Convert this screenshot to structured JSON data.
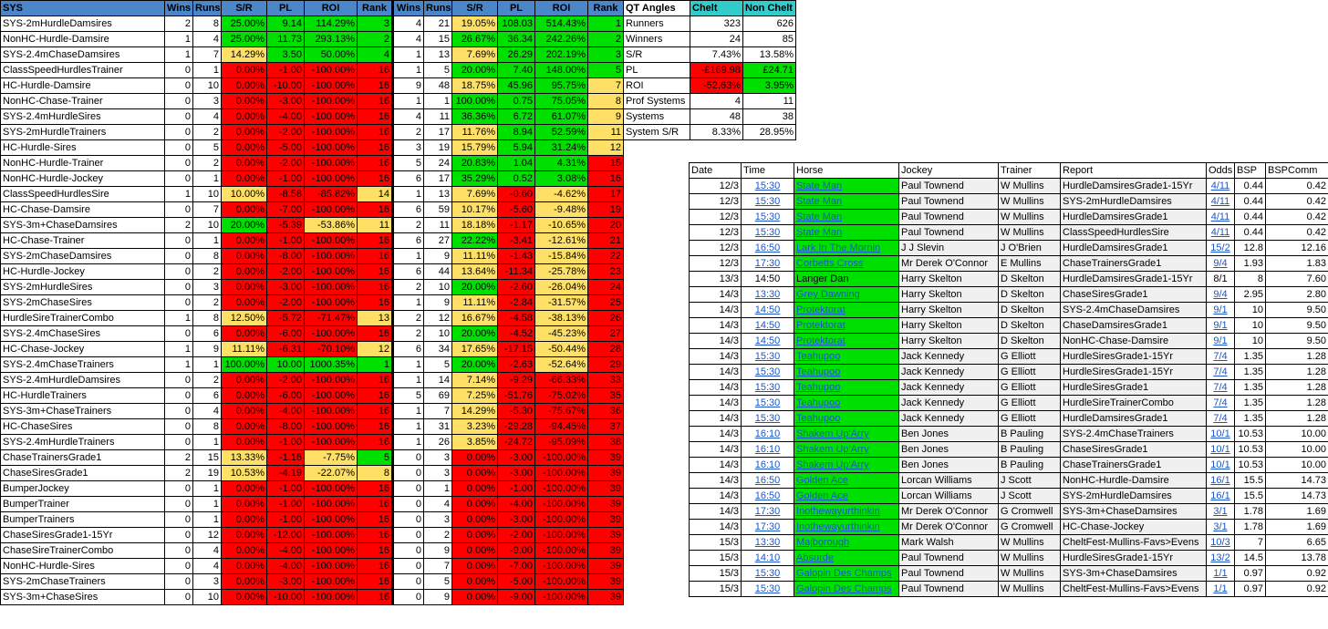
{
  "sys_headers": [
    "SYS",
    "Wins",
    "Runs",
    "S/R",
    "PL",
    "ROI",
    "Rank",
    "Wins",
    "Runs",
    "S/R",
    "PL",
    "ROI",
    "Rank"
  ],
  "sys_rows": [
    [
      "SYS-2mHurdleDamsires",
      "2",
      "8",
      "25.00%",
      "9.14",
      "114.29%",
      "3",
      "4",
      "21",
      "19.05%",
      "108.03",
      "514.43%",
      "1"
    ],
    [
      "NonHC-Hurdle-Damsire",
      "1",
      "4",
      "25.00%",
      "11.73",
      "293.13%",
      "2",
      "4",
      "15",
      "26.67%",
      "36.34",
      "242.26%",
      "2"
    ],
    [
      "SYS-2.4mChaseDamsires",
      "1",
      "7",
      "14.29%",
      "3.50",
      "50.00%",
      "4",
      "1",
      "13",
      "7.69%",
      "26.29",
      "202.19%",
      "3"
    ],
    [
      "ClassSpeedHurdlesTrainer",
      "0",
      "1",
      "0.00%",
      "-1.00",
      "-100.00%",
      "16",
      "1",
      "5",
      "20.00%",
      "7.40",
      "148.00%",
      "5"
    ],
    [
      "HC-Hurdle-Damsire",
      "0",
      "10",
      "0.00%",
      "-10.00",
      "-100.00%",
      "16",
      "9",
      "48",
      "18.75%",
      "45.96",
      "95.75%",
      "7"
    ],
    [
      "NonHC-Chase-Trainer",
      "0",
      "3",
      "0.00%",
      "-3.00",
      "-100.00%",
      "16",
      "1",
      "1",
      "100.00%",
      "0.75",
      "75.05%",
      "8"
    ],
    [
      "SYS-2.4mHurdleSires",
      "0",
      "4",
      "0.00%",
      "-4.00",
      "-100.00%",
      "16",
      "4",
      "11",
      "36.36%",
      "6.72",
      "61.07%",
      "9"
    ],
    [
      "SYS-2mHurdleTrainers",
      "0",
      "2",
      "0.00%",
      "-2.00",
      "-100.00%",
      "16",
      "2",
      "17",
      "11.76%",
      "8.94",
      "52.59%",
      "11"
    ],
    [
      "HC-Hurdle-Sires",
      "0",
      "5",
      "0.00%",
      "-5.00",
      "-100.00%",
      "16",
      "3",
      "19",
      "15.79%",
      "5.94",
      "31.24%",
      "12"
    ],
    [
      "NonHC-Hurdle-Trainer",
      "0",
      "2",
      "0.00%",
      "-2.00",
      "-100.00%",
      "16",
      "5",
      "24",
      "20.83%",
      "1.04",
      "4.31%",
      "15"
    ],
    [
      "NonHC-Hurdle-Jockey",
      "0",
      "1",
      "0.00%",
      "-1.00",
      "-100.00%",
      "16",
      "6",
      "17",
      "35.29%",
      "0.52",
      "3.08%",
      "16"
    ],
    [
      "ClassSpeedHurdlesSire",
      "1",
      "10",
      "10.00%",
      "-8.58",
      "-85.82%",
      "14",
      "1",
      "13",
      "7.69%",
      "-0.60",
      "-4.62%",
      "17"
    ],
    [
      "HC-Chase-Damsire",
      "0",
      "7",
      "0.00%",
      "-7.00",
      "-100.00%",
      "16",
      "6",
      "59",
      "10.17%",
      "-5.60",
      "-9.48%",
      "19"
    ],
    [
      "SYS-3m+ChaseDamsires",
      "2",
      "10",
      "20.00%",
      "-5.39",
      "-53.86%",
      "11",
      "2",
      "11",
      "18.18%",
      "-1.17",
      "-10.65%",
      "20"
    ],
    [
      "HC-Chase-Trainer",
      "0",
      "1",
      "0.00%",
      "-1.00",
      "-100.00%",
      "16",
      "6",
      "27",
      "22.22%",
      "-3.41",
      "-12.61%",
      "21"
    ],
    [
      "SYS-2mChaseDamsires",
      "0",
      "8",
      "0.00%",
      "-8.00",
      "-100.00%",
      "16",
      "1",
      "9",
      "11.11%",
      "-1.43",
      "-15.84%",
      "22"
    ],
    [
      "HC-Hurdle-Jockey",
      "0",
      "2",
      "0.00%",
      "-2.00",
      "-100.00%",
      "16",
      "6",
      "44",
      "13.64%",
      "-11.34",
      "-25.78%",
      "23"
    ],
    [
      "SYS-2mHurdleSires",
      "0",
      "3",
      "0.00%",
      "-3.00",
      "-100.00%",
      "16",
      "2",
      "10",
      "20.00%",
      "-2.60",
      "-26.04%",
      "24"
    ],
    [
      "SYS-2mChaseSires",
      "0",
      "2",
      "0.00%",
      "-2.00",
      "-100.00%",
      "16",
      "1",
      "9",
      "11.11%",
      "-2.84",
      "-31.57%",
      "25"
    ],
    [
      "HurdleSireTrainerCombo",
      "1",
      "8",
      "12.50%",
      "-5.72",
      "-71.47%",
      "13",
      "2",
      "12",
      "16.67%",
      "-4.58",
      "-38.13%",
      "26"
    ],
    [
      "SYS-2.4mChaseSires",
      "0",
      "6",
      "0.00%",
      "-6.00",
      "-100.00%",
      "16",
      "2",
      "10",
      "20.00%",
      "-4.52",
      "-45.23%",
      "27"
    ],
    [
      "HC-Chase-Jockey",
      "1",
      "9",
      "11.11%",
      "-6.31",
      "-70.10%",
      "12",
      "6",
      "34",
      "17.65%",
      "-17.15",
      "-50.44%",
      "28"
    ],
    [
      "SYS-2.4mChaseTrainers",
      "1",
      "1",
      "100.00%",
      "10.00",
      "1000.35%",
      "1",
      "1",
      "5",
      "20.00%",
      "-2.63",
      "-52.64%",
      "29"
    ],
    [
      "SYS-2.4mHurdleDamsires",
      "0",
      "2",
      "0.00%",
      "-2.00",
      "-100.00%",
      "16",
      "1",
      "14",
      "7.14%",
      "-9.29",
      "-66.33%",
      "33"
    ],
    [
      "HC-HurdleTrainers",
      "0",
      "6",
      "0.00%",
      "-6.00",
      "-100.00%",
      "16",
      "5",
      "69",
      "7.25%",
      "-51.76",
      "-75.02%",
      "35"
    ],
    [
      "SYS-3m+ChaseTrainers",
      "0",
      "4",
      "0.00%",
      "-4.00",
      "-100.00%",
      "16",
      "1",
      "7",
      "14.29%",
      "-5.30",
      "-75.67%",
      "36"
    ],
    [
      "HC-ChaseSires",
      "0",
      "8",
      "0.00%",
      "-8.00",
      "-100.00%",
      "16",
      "1",
      "31",
      "3.23%",
      "-29.28",
      "-94.45%",
      "37"
    ],
    [
      "SYS-2.4mHurdleTrainers",
      "0",
      "1",
      "0.00%",
      "-1.00",
      "-100.00%",
      "16",
      "1",
      "26",
      "3.85%",
      "-24.72",
      "-95.09%",
      "38"
    ],
    [
      "ChaseTrainersGrade1",
      "2",
      "15",
      "13.33%",
      "-1.16",
      "-7.75%",
      "5",
      "0",
      "3",
      "0.00%",
      "-3.00",
      "-100.00%",
      "39"
    ],
    [
      "ChaseSiresGrade1",
      "2",
      "19",
      "10.53%",
      "-4.19",
      "-22.07%",
      "8",
      "0",
      "3",
      "0.00%",
      "-3.00",
      "-100.00%",
      "39"
    ],
    [
      "BumperJockey",
      "0",
      "1",
      "0.00%",
      "-1.00",
      "-100.00%",
      "16",
      "0",
      "1",
      "0.00%",
      "-1.00",
      "-100.00%",
      "39"
    ],
    [
      "BumperTrainer",
      "0",
      "1",
      "0.00%",
      "-1.00",
      "-100.00%",
      "16",
      "0",
      "4",
      "0.00%",
      "-4.00",
      "-100.00%",
      "39"
    ],
    [
      "BumperTrainers",
      "0",
      "1",
      "0.00%",
      "-1.00",
      "-100.00%",
      "16",
      "0",
      "3",
      "0.00%",
      "-3.00",
      "-100.00%",
      "39"
    ],
    [
      "ChaseSiresGrade1-15Yr",
      "0",
      "12",
      "0.00%",
      "-12.00",
      "-100.00%",
      "16",
      "0",
      "2",
      "0.00%",
      "-2.00",
      "-100.00%",
      "39"
    ],
    [
      "ChaseSireTrainerCombo",
      "0",
      "4",
      "0.00%",
      "-4.00",
      "-100.00%",
      "16",
      "0",
      "9",
      "0.00%",
      "-9.00",
      "-100.00%",
      "39"
    ],
    [
      "NonHC-Hurdle-Sires",
      "0",
      "4",
      "0.00%",
      "-4.00",
      "-100.00%",
      "16",
      "0",
      "7",
      "0.00%",
      "-7.00",
      "-100.00%",
      "39"
    ],
    [
      "SYS-2mChaseTrainers",
      "0",
      "3",
      "0.00%",
      "-3.00",
      "-100.00%",
      "16",
      "0",
      "5",
      "0.00%",
      "-5.00",
      "-100.00%",
      "39"
    ],
    [
      "SYS-3m+ChaseSires",
      "0",
      "10",
      "0.00%",
      "-10.00",
      "-100.00%",
      "16",
      "0",
      "9",
      "0.00%",
      "-9.00",
      "-100.00%",
      "39"
    ]
  ],
  "qt": {
    "headers": [
      "QT Angles",
      "Chelt",
      "Non Chelt"
    ],
    "rows": [
      [
        "Runners",
        "323",
        "626"
      ],
      [
        "Winners",
        "24",
        "85"
      ],
      [
        "S/R",
        "7.43%",
        "13.58%"
      ],
      [
        "PL",
        "-£169.98",
        "£24.71"
      ],
      [
        "ROI",
        "-52.63%",
        "3.95%"
      ],
      [
        "Prof Systems",
        "4",
        "11"
      ],
      [
        "Systems",
        "48",
        "38"
      ],
      [
        "System S/R",
        "8.33%",
        "28.95%"
      ]
    ]
  },
  "races": {
    "headers": [
      "Date",
      "Time",
      "Horse",
      "Jockey",
      "Trainer",
      "Report",
      "Odds",
      "BSP",
      "BSPComm"
    ],
    "rows": [
      [
        "12/3",
        "15:30",
        "State Man",
        "Paul Townend",
        "W Mullins",
        "HurdleDamsiresGrade1-15Yr",
        "4/11",
        "0.44",
        "0.42"
      ],
      [
        "12/3",
        "15:30",
        "State Man",
        "Paul Townend",
        "W Mullins",
        "SYS-2mHurdleDamsires",
        "4/11",
        "0.44",
        "0.42"
      ],
      [
        "12/3",
        "15:30",
        "State Man",
        "Paul Townend",
        "W Mullins",
        "HurdleDamsiresGrade1",
        "4/11",
        "0.44",
        "0.42"
      ],
      [
        "12/3",
        "15:30",
        "State Man",
        "Paul Townend",
        "W Mullins",
        "ClassSpeedHurdlesSire",
        "4/11",
        "0.44",
        "0.42"
      ],
      [
        "12/3",
        "16:50",
        "Lark In The Mornin",
        "J J Slevin",
        "J O'Brien",
        "HurdleDamsiresGrade1",
        "15/2",
        "12.8",
        "12.16"
      ],
      [
        "12/3",
        "17:30",
        "Corbetts Cross",
        "Mr Derek O'Connor",
        "E Mullins",
        "ChaseTrainersGrade1",
        "9/4",
        "1.93",
        "1.83"
      ],
      [
        "13/3",
        "14:50",
        "Langer Dan",
        "Harry Skelton",
        "D Skelton",
        "HurdleDamsiresGrade1-15Yr",
        "8/1",
        "8",
        "7.60"
      ],
      [
        "14/3",
        "13:30",
        "Grey Dawning",
        "Harry Skelton",
        "D Skelton",
        "ChaseSiresGrade1",
        "9/4",
        "2.95",
        "2.80"
      ],
      [
        "14/3",
        "14:50",
        "Protektorat",
        "Harry Skelton",
        "D Skelton",
        "SYS-2.4mChaseDamsires",
        "9/1",
        "10",
        "9.50"
      ],
      [
        "14/3",
        "14:50",
        "Protektorat",
        "Harry Skelton",
        "D Skelton",
        "ChaseDamsiresGrade1",
        "9/1",
        "10",
        "9.50"
      ],
      [
        "14/3",
        "14:50",
        "Protektorat",
        "Harry Skelton",
        "D Skelton",
        "NonHC-Chase-Damsire",
        "9/1",
        "10",
        "9.50"
      ],
      [
        "14/3",
        "15:30",
        "Teahupoo",
        "Jack Kennedy",
        "G Elliott",
        "HurdleSiresGrade1-15Yr",
        "7/4",
        "1.35",
        "1.28"
      ],
      [
        "14/3",
        "15:30",
        "Teahupoo",
        "Jack Kennedy",
        "G Elliott",
        "HurdleSiresGrade1-15Yr",
        "7/4",
        "1.35",
        "1.28"
      ],
      [
        "14/3",
        "15:30",
        "Teahupoo",
        "Jack Kennedy",
        "G Elliott",
        "HurdleSiresGrade1",
        "7/4",
        "1.35",
        "1.28"
      ],
      [
        "14/3",
        "15:30",
        "Teahupoo",
        "Jack Kennedy",
        "G Elliott",
        "HurdleSireTrainerCombo",
        "7/4",
        "1.35",
        "1.28"
      ],
      [
        "14/3",
        "15:30",
        "Teahupoo",
        "Jack Kennedy",
        "G Elliott",
        "HurdleDamsiresGrade1",
        "7/4",
        "1.35",
        "1.28"
      ],
      [
        "14/3",
        "16:10",
        "Shakem Up'Arry",
        "Ben Jones",
        "B Pauling",
        "SYS-2.4mChaseTrainers",
        "10/1",
        "10.53",
        "10.00"
      ],
      [
        "14/3",
        "16:10",
        "Shakem Up'Arry",
        "Ben Jones",
        "B Pauling",
        "ChaseSiresGrade1",
        "10/1",
        "10.53",
        "10.00"
      ],
      [
        "14/3",
        "16:10",
        "Shakem Up'Arry",
        "Ben Jones",
        "B Pauling",
        "ChaseTrainersGrade1",
        "10/1",
        "10.53",
        "10.00"
      ],
      [
        "14/3",
        "16:50",
        "Golden Ace",
        "Lorcan Williams",
        "J Scott",
        "NonHC-Hurdle-Damsire",
        "16/1",
        "15.5",
        "14.73"
      ],
      [
        "14/3",
        "16:50",
        "Golden Ace",
        "Lorcan Williams",
        "J Scott",
        "SYS-2mHurdleDamsires",
        "16/1",
        "15.5",
        "14.73"
      ],
      [
        "14/3",
        "17:30",
        "Inothewayurthinkin",
        "Mr Derek O'Connor",
        "G Cromwell",
        "SYS-3m+ChaseDamsires",
        "3/1",
        "1.78",
        "1.69"
      ],
      [
        "14/3",
        "17:30",
        "Inothewayurthinkin",
        "Mr Derek O'Connor",
        "G Cromwell",
        "HC-Chase-Jockey",
        "3/1",
        "1.78",
        "1.69"
      ],
      [
        "15/3",
        "13:30",
        "Majborough",
        "Mark Walsh",
        "W Mullins",
        "CheltFest-Mullins-Favs>Evens",
        "10/3",
        "7",
        "6.65"
      ],
      [
        "15/3",
        "14:10",
        "Absurde",
        "Paul Townend",
        "W Mullins",
        "HurdleSiresGrade1-15Yr",
        "13/2",
        "14.5",
        "13.78"
      ],
      [
        "15/3",
        "15:30",
        "Galopin Des Champs",
        "Paul Townend",
        "W Mullins",
        "SYS-3m+ChaseDamsires",
        "1/1",
        "0.97",
        "0.92"
      ],
      [
        "15/3",
        "15:30",
        "Galopin Des Champs",
        "Paul Townend",
        "W Mullins",
        "CheltFest-Mullins-Favs>Evens",
        "1/1",
        "0.97",
        "0.92"
      ]
    ]
  },
  "colors": {
    "header_blue": "#4a86c8",
    "header_teal": "#33cccc",
    "green": "#00e000",
    "red": "#ff0000",
    "yellow": "#ffe066",
    "link_blue": "#1a56c8"
  }
}
